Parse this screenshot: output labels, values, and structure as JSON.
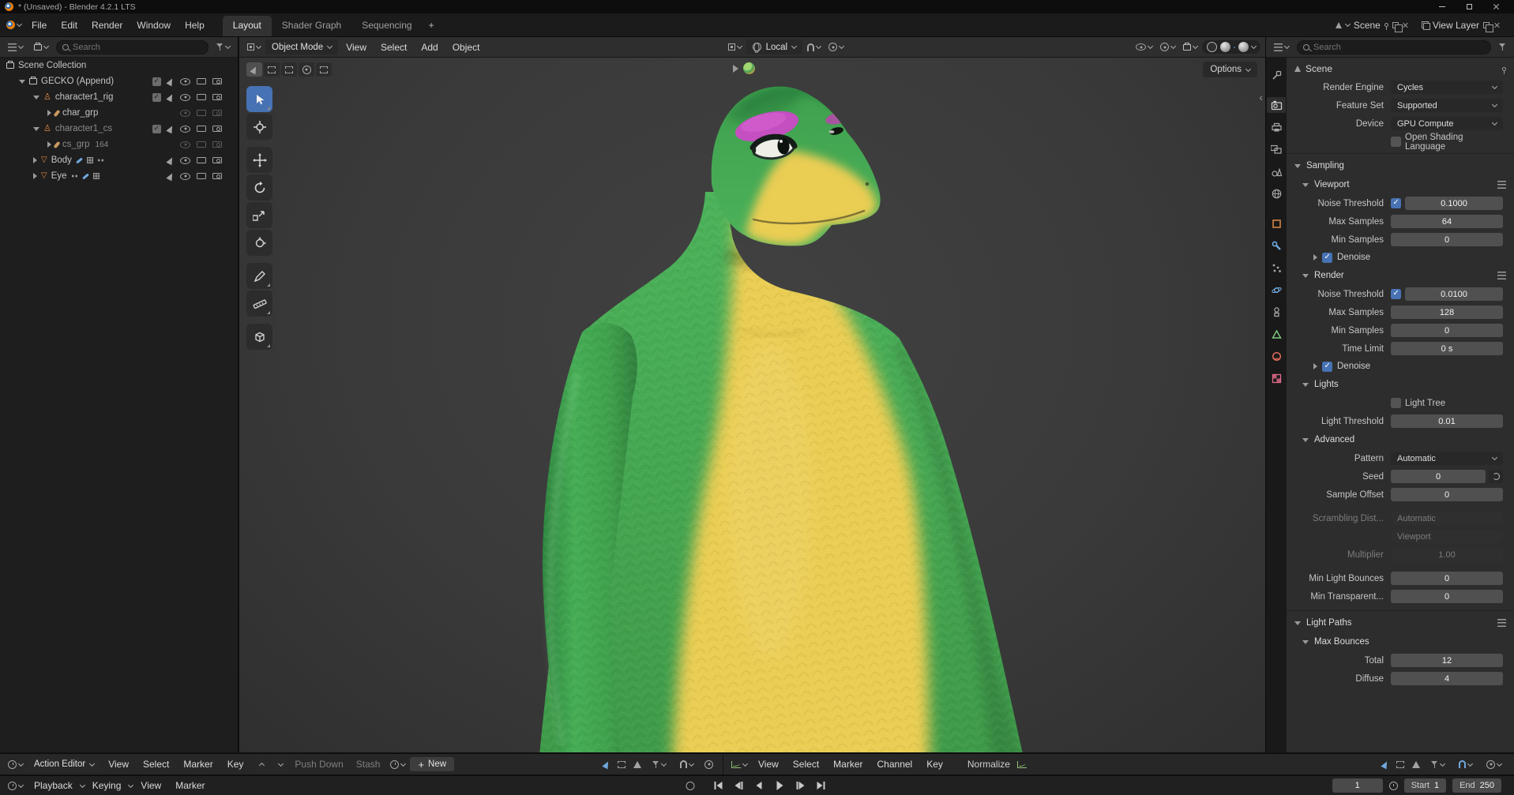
{
  "window": {
    "title": "* (Unsaved) - Blender 4.2.1 LTS"
  },
  "topbar": {
    "menus": [
      "File",
      "Edit",
      "Render",
      "Window",
      "Help"
    ],
    "workspaces": [
      "Layout",
      "Shader Graph",
      "Sequencing"
    ],
    "workspace_add": "+",
    "scene": "Scene",
    "view_layer": "View Layer"
  },
  "outliner": {
    "search_placeholder": "Search",
    "rows": [
      {
        "label": "Scene Collection",
        "icon": "collection"
      },
      {
        "label": "GECKO (Append)",
        "icon": "collection"
      },
      {
        "label": "character1_rig",
        "icon": "armature"
      },
      {
        "label": "char_grp",
        "icon": "armature-data"
      },
      {
        "label": "character1_cs",
        "icon": "armature"
      },
      {
        "label": "cs_grp",
        "icon": "armature-data",
        "badge": "164"
      },
      {
        "label": "Body",
        "icon": "mesh",
        "extra_icons": [
          "modifier-wrench",
          "vertex-grid",
          "dots"
        ]
      },
      {
        "label": "Eye",
        "icon": "mesh",
        "extra_icons": [
          "dots",
          "modifier-wrench",
          "vertex-grid"
        ]
      }
    ]
  },
  "viewport": {
    "mode": "Object Mode",
    "menus": [
      "View",
      "Select",
      "Add",
      "Object"
    ],
    "orientation": "Local",
    "options": "Options"
  },
  "properties": {
    "search_placeholder": "Search",
    "breadcrumb": "Scene",
    "render_engine": {
      "label": "Render Engine",
      "value": "Cycles"
    },
    "feature_set": {
      "label": "Feature Set",
      "value": "Supported"
    },
    "device": {
      "label": "Device",
      "value": "GPU Compute"
    },
    "osl": {
      "label": "Open Shading Language"
    },
    "sampling": {
      "title": "Sampling",
      "viewport": {
        "title": "Viewport",
        "noise_threshold": {
          "label": "Noise Threshold",
          "value": "0.1000"
        },
        "max_samples": {
          "label": "Max Samples",
          "value": "64"
        },
        "min_samples": {
          "label": "Min Samples",
          "value": "0"
        },
        "denoise": {
          "label": "Denoise"
        }
      },
      "render": {
        "title": "Render",
        "noise_threshold": {
          "label": "Noise Threshold",
          "value": "0.0100"
        },
        "max_samples": {
          "label": "Max Samples",
          "value": "128"
        },
        "min_samples": {
          "label": "Min Samples",
          "value": "0"
        },
        "time_limit": {
          "label": "Time Limit",
          "value": "0 s"
        },
        "denoise": {
          "label": "Denoise"
        }
      },
      "lights": {
        "title": "Lights",
        "light_tree": {
          "label": "Light Tree"
        },
        "light_threshold": {
          "label": "Light Threshold",
          "value": "0.01"
        }
      },
      "advanced": {
        "title": "Advanced",
        "pattern": {
          "label": "Pattern",
          "value": "Automatic"
        },
        "seed": {
          "label": "Seed",
          "value": "0"
        },
        "sample_offset": {
          "label": "Sample Offset",
          "value": "0"
        },
        "scrambling_distance": {
          "label": "Scrambling Dist...",
          "value": "Automatic"
        },
        "scrambling_viewport": {
          "value": "Viewport"
        },
        "multiplier": {
          "label": "Multiplier",
          "value": "1.00"
        },
        "min_light_bounces": {
          "label": "Min Light Bounces",
          "value": "0"
        },
        "min_transparent": {
          "label": "Min Transparent...",
          "value": "0"
        }
      }
    },
    "light_paths": {
      "title": "Light Paths",
      "max_bounces": {
        "title": "Max Bounces",
        "total": {
          "label": "Total",
          "value": "12"
        },
        "diffuse": {
          "label": "Diffuse",
          "value": "4"
        }
      }
    }
  },
  "dopesheet": {
    "mode": "Action Editor",
    "menus": [
      "View",
      "Select",
      "Marker",
      "Key"
    ],
    "push_down": "Push Down",
    "stash": "Stash",
    "new_label": "New"
  },
  "graph": {
    "menus": [
      "View",
      "Select",
      "Marker",
      "Channel",
      "Key"
    ],
    "normalize": "Normalize"
  },
  "timeline": {
    "playback": "Playback",
    "keying": "Keying",
    "menus": [
      "View",
      "Marker"
    ],
    "frame": "1",
    "start_label": "Start",
    "start": "1",
    "end_label": "End",
    "end": "250"
  },
  "colors": {
    "accent_blue": "#4772b3",
    "object_orange": "#df8a47",
    "modifier_blue": "#6fa8dc",
    "data_green": "#7ec57e",
    "material_red": "#e06a5a",
    "gecko_green": "#45ad55",
    "gecko_yellow": "#eacd52",
    "gecko_pink": "#c84fc4"
  },
  "icons": {
    "search": "magnifier",
    "filter": "funnel",
    "snap": "magnet",
    "proportional": "concentric-circle",
    "auto_key": "record-circle",
    "shading_active": "material-preview-sphere"
  }
}
